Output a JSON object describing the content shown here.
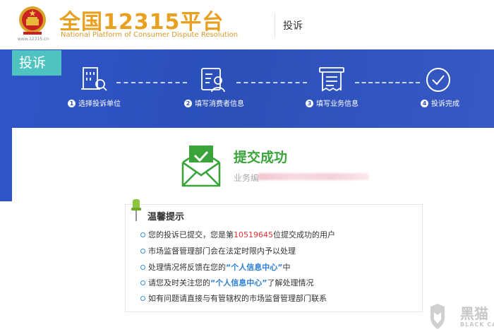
{
  "header": {
    "brand_title": "全国12315平台",
    "brand_subtitle": "National Platform of Consumer Dispute Resolution",
    "emblem_url": "www.12315.cn",
    "nav_item": "投诉"
  },
  "band": {
    "tab_label": "投诉",
    "steps": [
      {
        "num": "1",
        "label": "选择投诉单位",
        "icon": "building-search-icon"
      },
      {
        "num": "2",
        "label": "填写消费者信息",
        "icon": "user-form-icon"
      },
      {
        "num": "3",
        "label": "填写业务信息",
        "icon": "document-icon"
      },
      {
        "num": "4",
        "label": "投诉完成",
        "icon": "check-circle-icon"
      }
    ]
  },
  "result": {
    "title": "提交成功",
    "biz_label": "业务编"
  },
  "tips": {
    "title": "温馨提示",
    "line1_a": "您的投诉已提交，您是第",
    "line1_num": "10519645",
    "line1_b": "位提交成功的用户",
    "line2": "市场监督管理部门会在法定时限内予以处理",
    "line3_a": "处理情况将反馈在您的",
    "line3_link": "“个人信息中心”",
    "line3_b": "中",
    "line4_a": "请您及时关注您的",
    "line4_link": "“个人信息中心”",
    "line4_b": "了解处理情况",
    "line5": "如有问题请直接与有管辖权的市场监督管理部门联系"
  },
  "watermark": {
    "text": "黑猫",
    "sub": "BLACK CAT"
  },
  "colors": {
    "brand_orange": "#e8a021",
    "band_blue": "#2f55c8",
    "tab_teal": "#4fc3c0",
    "success_green": "#3aa43a",
    "highlight_red": "#e23232",
    "link_blue": "#2e7fd6"
  }
}
